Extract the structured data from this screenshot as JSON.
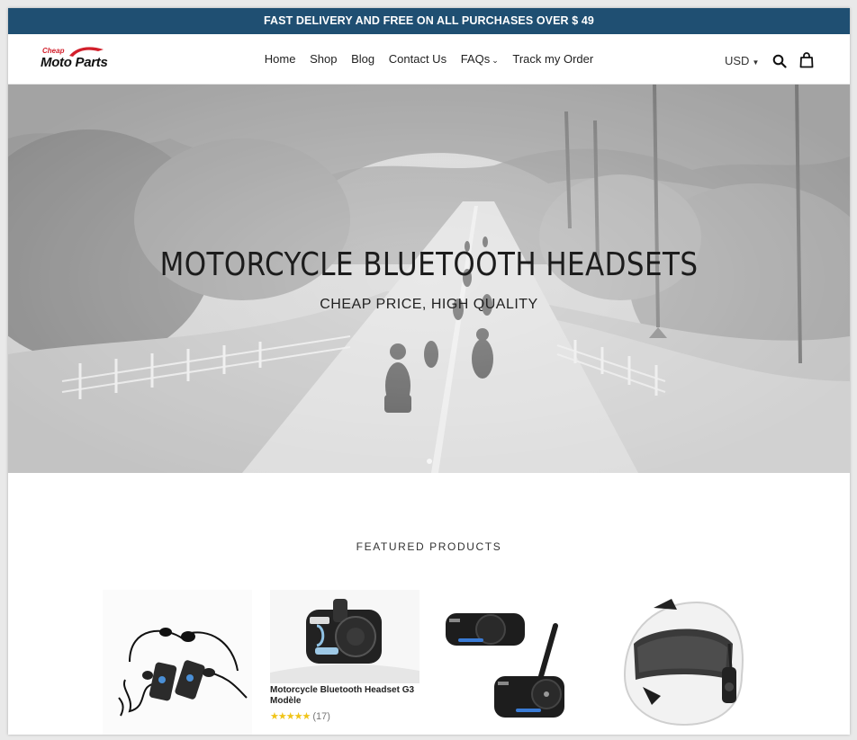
{
  "announcement": "FAST DELIVERY AND FREE ON ALL PURCHASES OVER $ 49",
  "logo": {
    "small": "Cheap",
    "big": "Moto Parts"
  },
  "nav": [
    {
      "label": "Home"
    },
    {
      "label": "Shop"
    },
    {
      "label": "Blog"
    },
    {
      "label": "Contact Us"
    },
    {
      "label": "FAQs"
    },
    {
      "label": "Track my Order"
    }
  ],
  "currency": "USD",
  "hero": {
    "title": "MOTORCYCLE BLUETOOTH HEADSETS",
    "subtitle": "CHEAP PRICE, HIGH QUALITY"
  },
  "featured_heading": "FEATURED PRODUCTS",
  "products": [
    {
      "image": "headset-kit-image"
    },
    {
      "image": "headset-g3-image",
      "title": "Motorcycle Bluetooth Headset G3 Modèle",
      "stars": "★★★★★",
      "reviews": "(17)"
    },
    {
      "image": "headset-pair-image"
    },
    {
      "image": "helmet-image"
    }
  ],
  "icons": {
    "search": "search-icon",
    "cart": "cart-icon",
    "dropdown": "chevron-down-icon"
  },
  "colors": {
    "announcement_bg": "#1f4f72",
    "star": "#f0c419"
  }
}
